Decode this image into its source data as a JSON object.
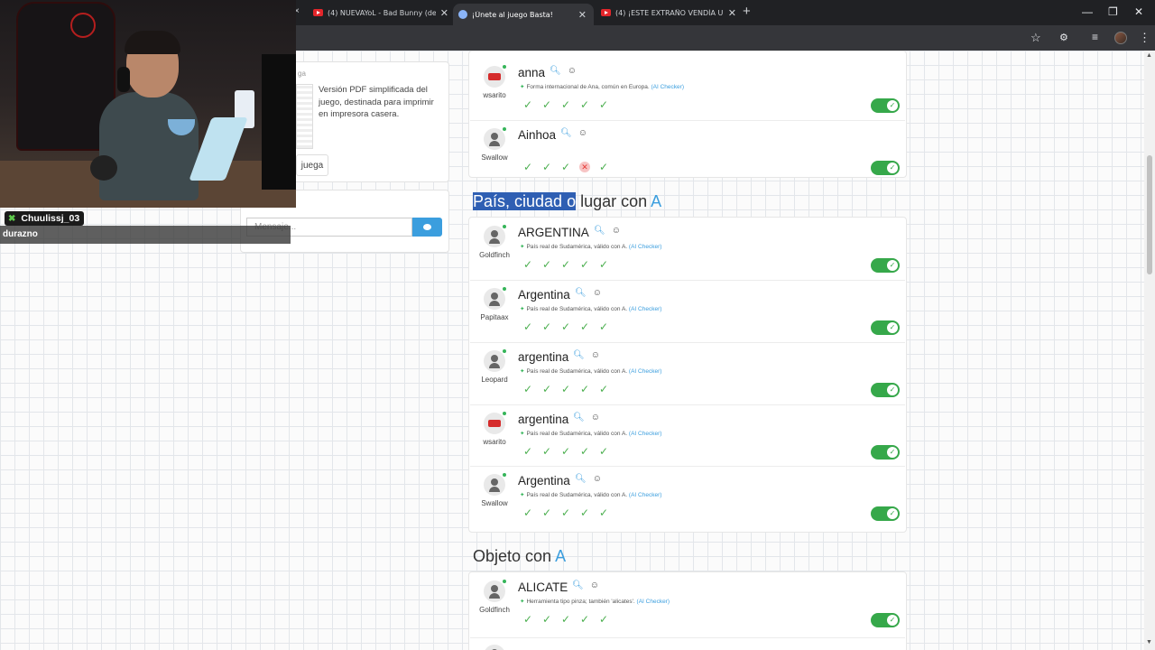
{
  "browser": {
    "tabs": [
      {
        "title": "(4) NUEVAYoL - Bad Bunny (de...",
        "icon": "youtube-icon",
        "active": false
      },
      {
        "title": "¡Únete al juego Basta!",
        "icon": "globe-icon",
        "active": true
      },
      {
        "title": "(4) ¡ESTE EXTRAÑO VENDÍA UN...",
        "icon": "youtube-icon",
        "active": false
      }
    ],
    "lead_close": "×",
    "new_tab": "+",
    "window_controls": {
      "minimize": "—",
      "maximize": "❐",
      "close": "✕"
    }
  },
  "side_panel": {
    "pdf_label": "ga",
    "pdf_description": "Versión PDF simplificada del juego, destinada para imprimir en impresora casera.",
    "juega_button": "juega",
    "message_placeholder": "Mensaje..."
  },
  "sections": [
    {
      "title": "",
      "entries": [
        {
          "answer": "anna",
          "player": "wsarito",
          "avatar": "logo",
          "note": "Forma internacional de Ana, común en Europa.",
          "checker": "(AI Checker)",
          "votes": [
            "ok",
            "ok",
            "ok",
            "ok",
            "ok"
          ],
          "valid": true
        },
        {
          "answer": "Ainhoa",
          "player": "Swallow",
          "avatar": "user",
          "note": "",
          "checker": "",
          "votes": [
            "ok",
            "ok",
            "ok",
            "no",
            "ok"
          ],
          "valid": true
        }
      ]
    },
    {
      "title_prefix": "País, ciudad o",
      "title_rest": " lugar con ",
      "letter": "A",
      "entries": [
        {
          "answer": "ARGENTINA",
          "player": "Goldfinch",
          "avatar": "user",
          "note": "País real de Sudamérica, válido con A.",
          "checker": "(AI Checker)",
          "votes": [
            "ok",
            "ok",
            "ok",
            "ok",
            "ok"
          ],
          "valid": true
        },
        {
          "answer": "Argentina",
          "player": "Papitaax",
          "avatar": "user",
          "note": "País real de Sudamérica, válido con A.",
          "checker": "(AI Checker)",
          "votes": [
            "ok",
            "ok",
            "ok",
            "ok",
            "ok"
          ],
          "valid": true
        },
        {
          "answer": "argentina",
          "player": "Leopard",
          "avatar": "user",
          "note": "País real de Sudamérica, válido con A.",
          "checker": "(AI Checker)",
          "votes": [
            "ok",
            "ok",
            "ok",
            "ok",
            "ok"
          ],
          "valid": true
        },
        {
          "answer": "argentina",
          "player": "wsarito",
          "avatar": "logo",
          "note": "País real de Sudamérica, válido con A.",
          "checker": "(AI Checker)",
          "votes": [
            "ok",
            "ok",
            "ok",
            "ok",
            "ok"
          ],
          "valid": true
        },
        {
          "answer": "Argentina",
          "player": "Swallow",
          "avatar": "user",
          "note": "País real de Sudamérica, válido con A.",
          "checker": "(AI Checker)",
          "votes": [
            "ok",
            "ok",
            "ok",
            "ok",
            "ok"
          ],
          "valid": true
        }
      ]
    },
    {
      "title": "Objeto con ",
      "letter": "A",
      "entries": [
        {
          "answer": "ALICATE",
          "player": "Goldfinch",
          "avatar": "user",
          "note": "Herramienta tipo pinza; también 'alicates'.",
          "checker": "(AI Checker)",
          "votes": [
            "ok",
            "ok",
            "ok",
            "ok",
            "ok"
          ],
          "valid": true
        }
      ]
    }
  ],
  "stream_overlay": {
    "chat_username": "Chuulissj_03",
    "chat_message": "durazno"
  },
  "colors": {
    "accent": "#3b9ede",
    "valid": "#36a84a",
    "highlight": "#2f5fb3"
  }
}
